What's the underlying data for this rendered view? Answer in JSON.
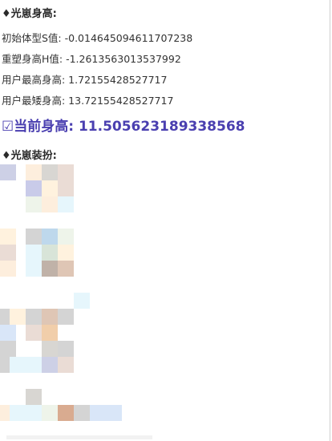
{
  "height_section": {
    "title": "♦光崽身高:",
    "lines": [
      "初始体型S值: -0.014645094611707238",
      "重塑身高H值: -1.2613563013537992",
      "用户最高身高: 1.72155428527717",
      "用户最矮身高: 13.72155428527717"
    ],
    "current": "☑当前身高: 11.505623189338568"
  },
  "outfit_section": {
    "title": "♦光崽装扮:"
  },
  "mosaic_colors": {
    "lavender": "#cdd0e6",
    "peach": "#fdeedd",
    "gray": "#d8d6d2",
    "pink_beige": "#eadcd5",
    "periwinkle": "#c9cbe9",
    "cream": "#fff2de",
    "mint_white": "#eef4ea",
    "ice_blue": "#e6f6fc",
    "light_gray": "#d4d4d4",
    "sky": "#bed8ec",
    "sage": "#d8e4d8",
    "taupe": "#c0b2a8",
    "tan": "#dfc6b5",
    "apricot": "#f1ceaa",
    "brown_peach": "#d9ab90",
    "soft_blue": "#d9e6f8"
  }
}
